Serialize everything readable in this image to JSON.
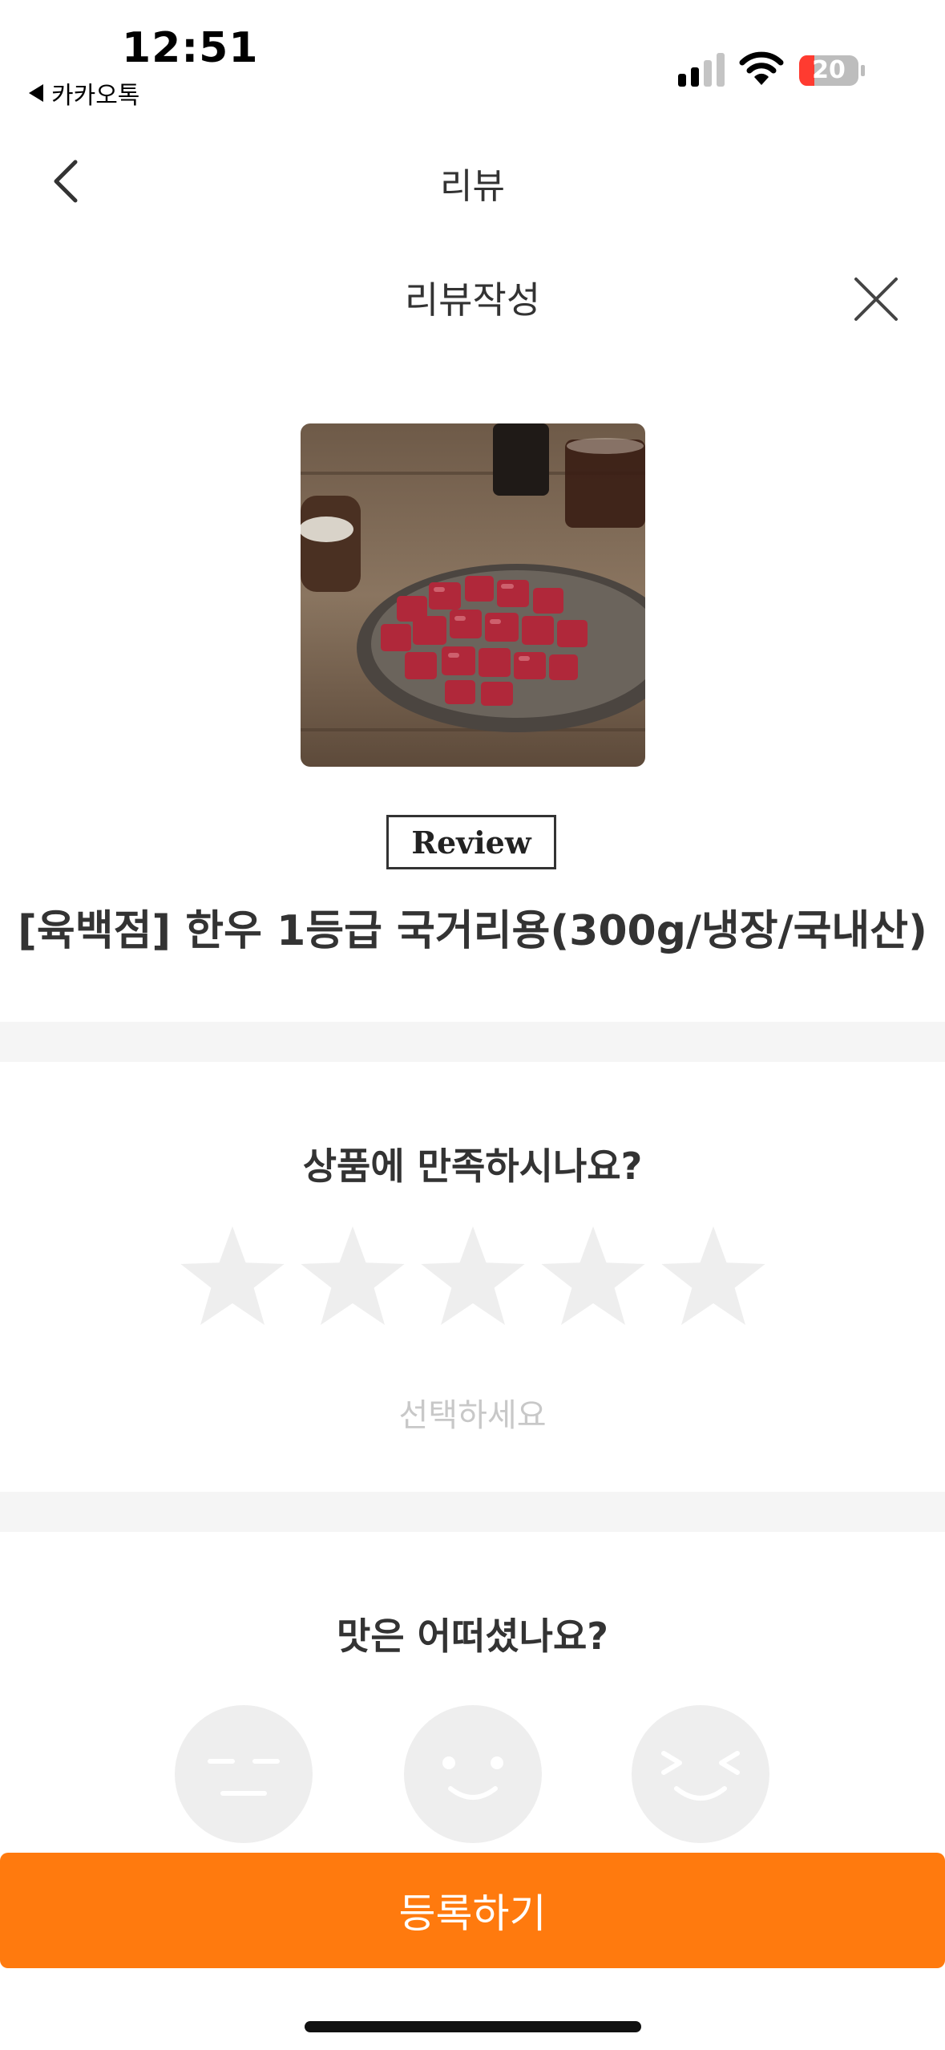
{
  "status_bar": {
    "time": "12:51",
    "back_app": "카카오톡",
    "battery_level": "20"
  },
  "nav": {
    "title": "리뷰",
    "back_icon": "chevron-left-icon"
  },
  "modal": {
    "title": "리뷰작성",
    "close_icon": "close-icon"
  },
  "product": {
    "image_desc_icon": "product-photo",
    "badge": "Review",
    "name": "[육백점] 한우 1등급 국거리용(300g/냉장/국내산)"
  },
  "rating": {
    "question": "상품에 만족하시나요?",
    "stars_total": 5,
    "stars_selected": 0,
    "hint": "선택하세요",
    "star_color": "#eeeeee"
  },
  "taste": {
    "question": "맛은 어떠셨나요?",
    "options": [
      "unimpressed-face-icon",
      "smile-face-icon",
      "grin-face-icon"
    ]
  },
  "submit": {
    "label": "등록하기",
    "color": "#ff7a0e"
  }
}
